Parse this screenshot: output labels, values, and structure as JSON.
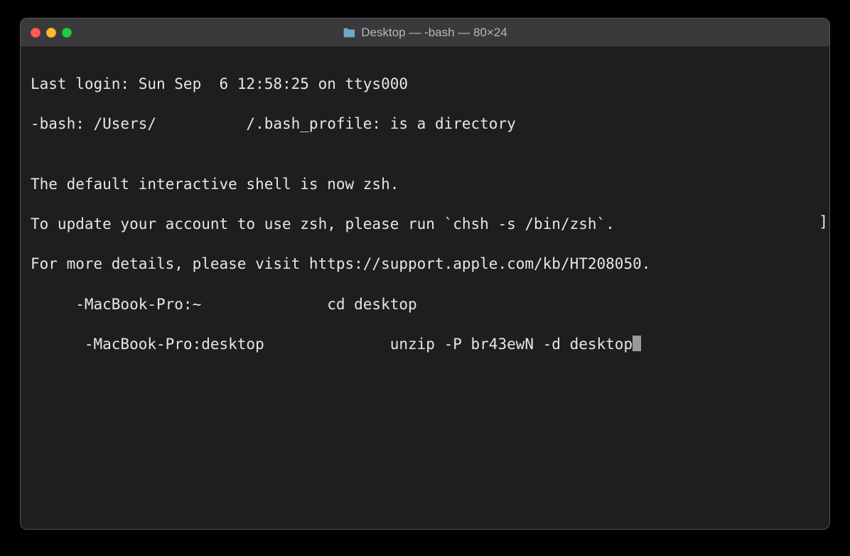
{
  "window": {
    "title": "Desktop — -bash — 80×24"
  },
  "terminal": {
    "line1": "Last login: Sun Sep  6 12:58:25 on ttys000",
    "line2": "-bash: /Users/          /.bash_profile: is a directory",
    "line3": "",
    "line4": "The default interactive shell is now zsh.",
    "line5": "To update your account to use zsh, please run `chsh -s /bin/zsh`.",
    "line6": "For more details, please visit https://support.apple.com/kb/HT208050.",
    "line7": "     -MacBook-Pro:~              cd desktop",
    "line8": "      -MacBook-Pro:desktop              unzip -P br43ewN -d desktop",
    "bracket": "]"
  }
}
